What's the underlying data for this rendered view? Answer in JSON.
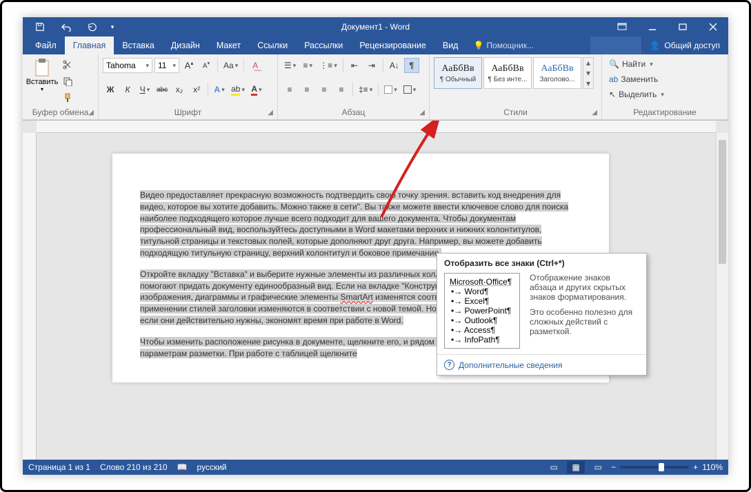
{
  "title": "Документ1 - Word",
  "tabs": {
    "file": "Файл",
    "home": "Главная",
    "insert": "Вставка",
    "design": "Дизайн",
    "layout": "Макет",
    "references": "Ссылки",
    "mailings": "Рассылки",
    "review": "Рецензирование",
    "view": "Вид"
  },
  "help_placeholder": "Помощник...",
  "share": "Общий доступ",
  "groups": {
    "clipboard": "Буфер обмена",
    "font": "Шрифт",
    "para": "Абзац",
    "styles": "Стили",
    "editing": "Редактирование"
  },
  "paste": "Вставить",
  "font": {
    "name": "Tahoma",
    "size": "11"
  },
  "fontbtns": {
    "bold": "Ж",
    "italic": "К",
    "underline": "Ч",
    "strike": "abc",
    "sub": "x₂",
    "sup": "x²",
    "grow": "A",
    "shrink": "A",
    "case": "Aa",
    "clear": "A",
    "color": "A",
    "effects": "A"
  },
  "styles": [
    {
      "prev": "АаБбВв",
      "name": "¶ Обычный"
    },
    {
      "prev": "АаБбВв",
      "name": "¶ Без инте..."
    },
    {
      "prev": "АаБбВв",
      "name": "Заголово..."
    }
  ],
  "editing": {
    "find": "Найти",
    "replace": "Заменить",
    "select": "Выделить"
  },
  "tooltip": {
    "title": "Отобразить все знаки (Ctrl+*)",
    "list_head": "Microsoft·Office¶",
    "items": [
      "•→ Word¶",
      "•→ Excel¶",
      "•→ PowerPoint¶",
      "•→ Outlook¶",
      "•→ Access¶",
      "•→ InfoPath¶"
    ],
    "desc1": "Отображение знаков абзаца и других скрытых знаков форматирования.",
    "desc2": "Это особенно полезно для сложных действий с разметкой.",
    "more": "Дополнительные сведения"
  },
  "doc": {
    "p1": "Видео  предоставляет прекрасную возможность подтвердить свою точку зрения. вставить код  внедрения для видео,        которое  вы хотите добавить. Можно  также в сети\". Вы  также можете ввести ключевое слово для поиска наиболее подходящего которое лучше всего подходит       для вашего документа. Чтобы  документам   профессиональный вид, воспользуйтесь доступными в Word макетами верхних и нижних колонтитулов,        титульной страницы и текстовых   полей, которые дополняют друг друга. Например,      вы можете добавить подходящую титульную страницу, верхний колонтитул и боковое примечание.",
    "p2a": "Откройте        вкладку \"Вставка\" и выберите нужные элементы из различных коллекций.              Темы и стили также помогают придать документу единообразный вид.          Если на вкладке \"Конструктор\"        выбрать другую тему, то изображения, диаграммы и графические элементы         ",
    "p2b": "SmartArt",
    "p2c": " изменятся соответствующим образом. При применении стилей заголовки изменяются в соответствии с новой темой. Новые кнопки, которые видны, только если         они действительно нужны, экономят время при работе в Word.",
    "p3": "Чтобы изменить      расположение рисунка в документе,         щелкните его, и рядом с ним появится кнопка для доступа к параметрам разметки.   При работе с таблицей щелкните"
  },
  "status": {
    "page": "Страница 1 из 1",
    "words": "Слово 210 из 210",
    "lang": "русский",
    "zoom": "110%"
  }
}
